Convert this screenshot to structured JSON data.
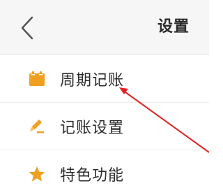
{
  "header": {
    "title": "设置",
    "back_icon": "chevron-left-icon"
  },
  "menu": {
    "items": [
      {
        "label": "周期记账",
        "icon": "calendar-icon"
      },
      {
        "label": "记账设置",
        "icon": "pencil-icon"
      },
      {
        "label": "特色功能",
        "icon": "star-icon"
      }
    ]
  },
  "colors": {
    "icon_orange": "#f0a020",
    "annotation_red": "#e02424",
    "header_bg": "#f6f6f6"
  }
}
